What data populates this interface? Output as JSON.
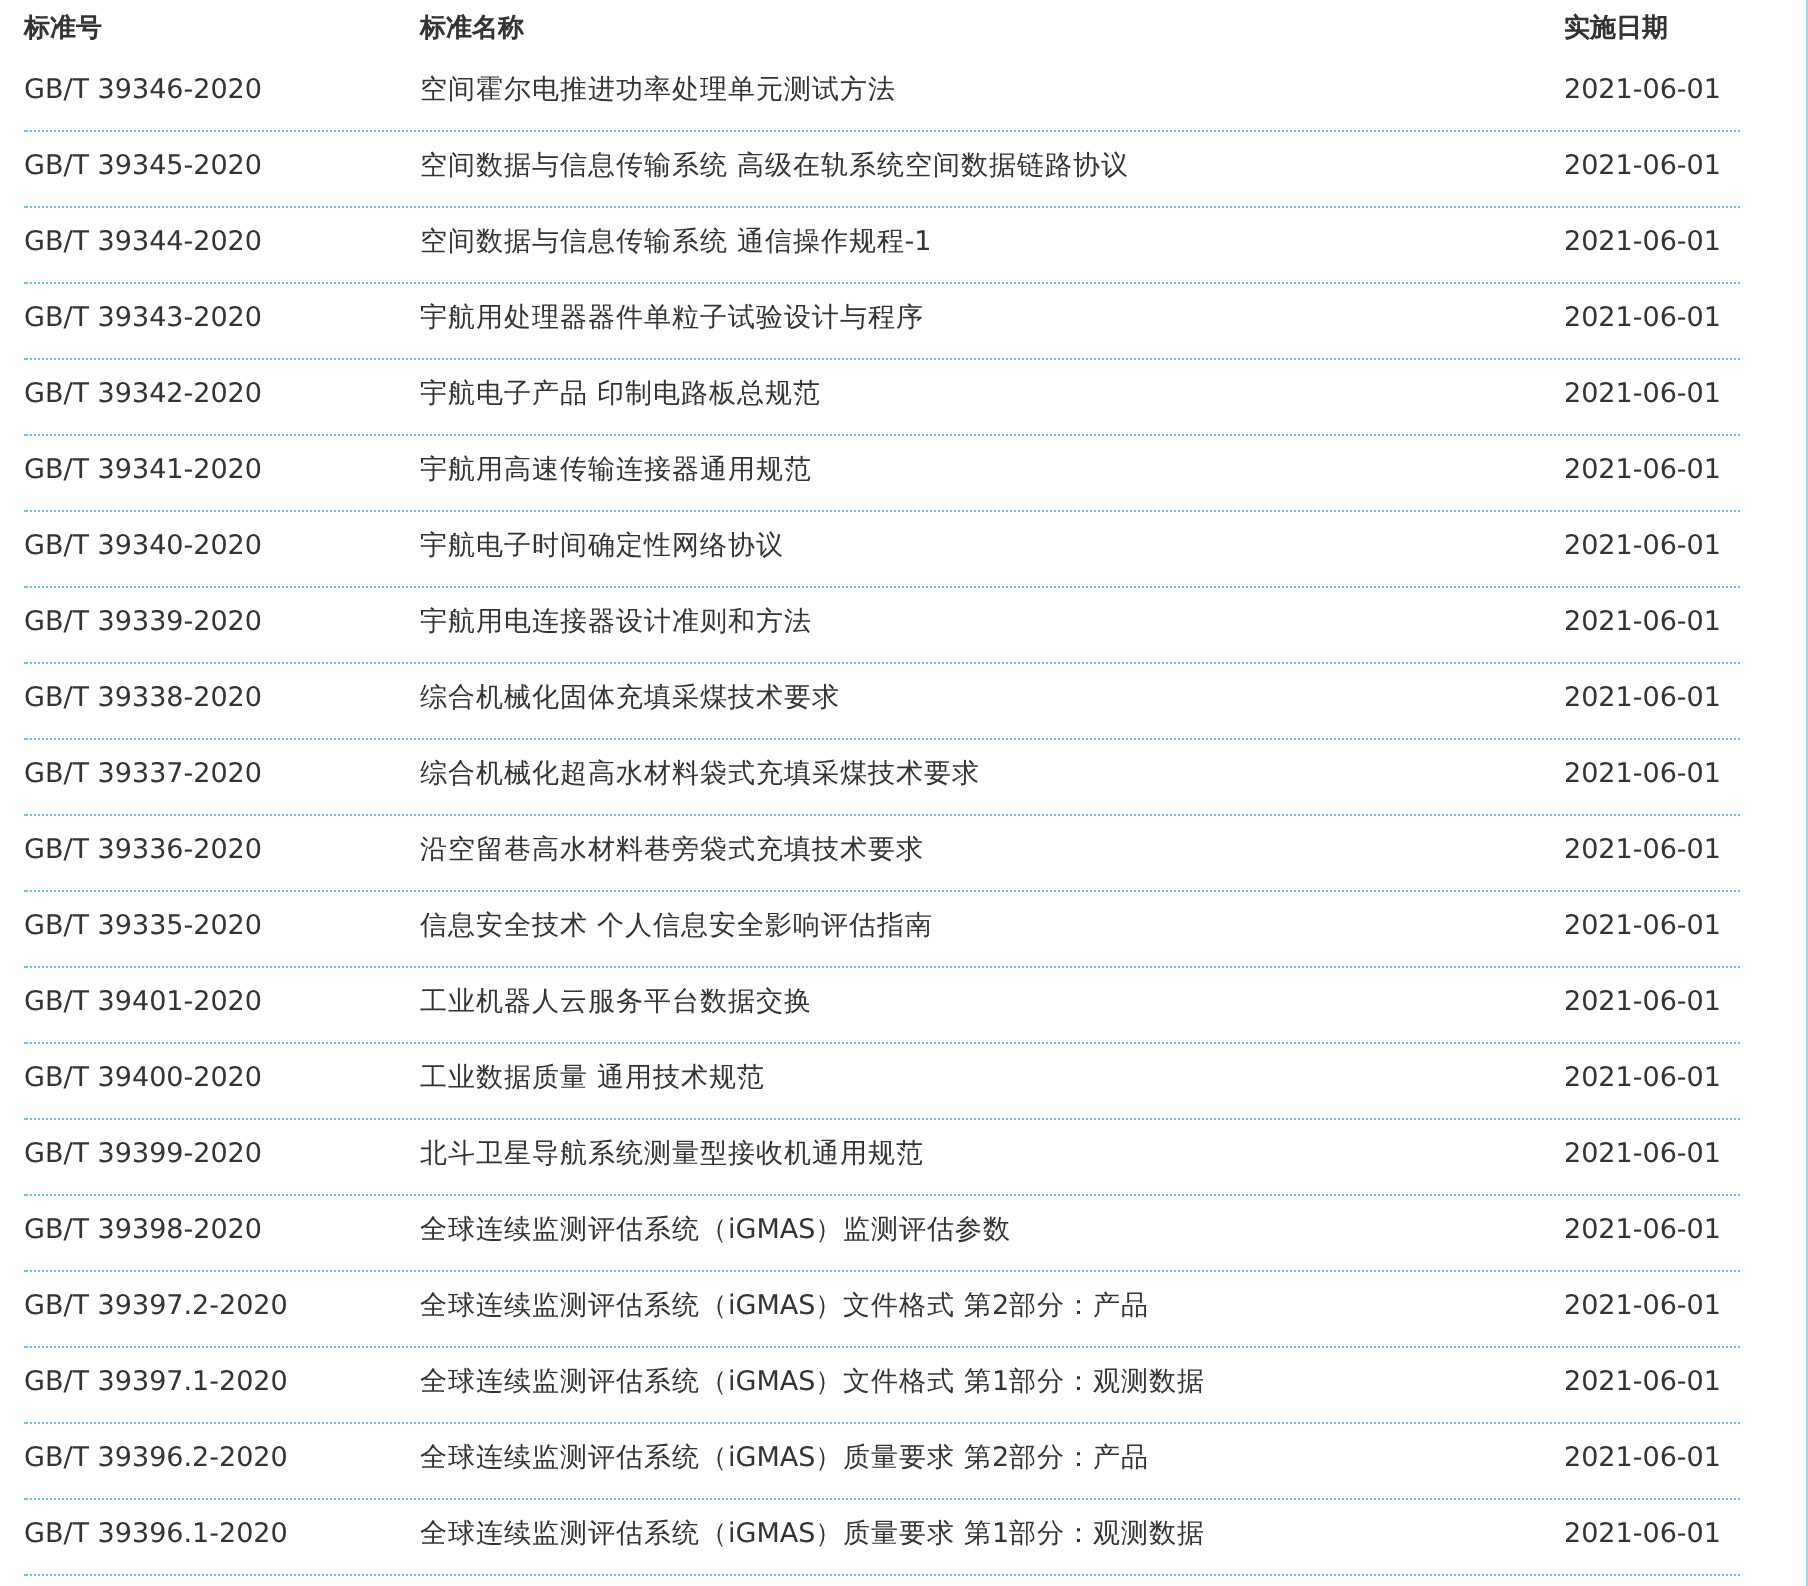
{
  "table": {
    "columns": [
      "标准号",
      "标准名称",
      "实施日期"
    ],
    "rows": [
      [
        "GB/T 39346-2020",
        "空间霍尔电推进功率处理单元测试方法",
        "2021-06-01"
      ],
      [
        "GB/T 39345-2020",
        "空间数据与信息传输系统 高级在轨系统空间数据链路协议",
        "2021-06-01"
      ],
      [
        "GB/T 39344-2020",
        "空间数据与信息传输系统 通信操作规程-1",
        "2021-06-01"
      ],
      [
        "GB/T 39343-2020",
        "宇航用处理器器件单粒子试验设计与程序",
        "2021-06-01"
      ],
      [
        "GB/T 39342-2020",
        "宇航电子产品 印制电路板总规范",
        "2021-06-01"
      ],
      [
        "GB/T 39341-2020",
        "宇航用高速传输连接器通用规范",
        "2021-06-01"
      ],
      [
        "GB/T 39340-2020",
        "宇航电子时间确定性网络协议",
        "2021-06-01"
      ],
      [
        "GB/T 39339-2020",
        "宇航用电连接器设计准则和方法",
        "2021-06-01"
      ],
      [
        "GB/T 39338-2020",
        "综合机械化固体充填采煤技术要求",
        "2021-06-01"
      ],
      [
        "GB/T 39337-2020",
        "综合机械化超高水材料袋式充填采煤技术要求",
        "2021-06-01"
      ],
      [
        "GB/T 39336-2020",
        "沿空留巷高水材料巷旁袋式充填技术要求",
        "2021-06-01"
      ],
      [
        "GB/T 39335-2020",
        "信息安全技术 个人信息安全影响评估指南",
        "2021-06-01"
      ],
      [
        "GB/T 39401-2020",
        "工业机器人云服务平台数据交换",
        "2021-06-01"
      ],
      [
        "GB/T 39400-2020",
        "工业数据质量 通用技术规范",
        "2021-06-01"
      ],
      [
        "GB/T 39399-2020",
        "北斗卫星导航系统测量型接收机通用规范",
        "2021-06-01"
      ],
      [
        "GB/T 39398-2020",
        "全球连续监测评估系统（iGMAS）监测评估参数",
        "2021-06-01"
      ],
      [
        "GB/T 39397.2-2020",
        "全球连续监测评估系统（iGMAS）文件格式 第2部分：产品",
        "2021-06-01"
      ],
      [
        "GB/T 39397.1-2020",
        "全球连续监测评估系统（iGMAS）文件格式 第1部分：观测数据",
        "2021-06-01"
      ],
      [
        "GB/T 39396.2-2020",
        "全球连续监测评估系统（iGMAS）质量要求 第2部分：产品",
        "2021-06-01"
      ],
      [
        "GB/T 39396.1-2020",
        "全球连续监测评估系统（iGMAS）质量要求 第1部分：观测数据",
        "2021-06-01"
      ]
    ]
  }
}
